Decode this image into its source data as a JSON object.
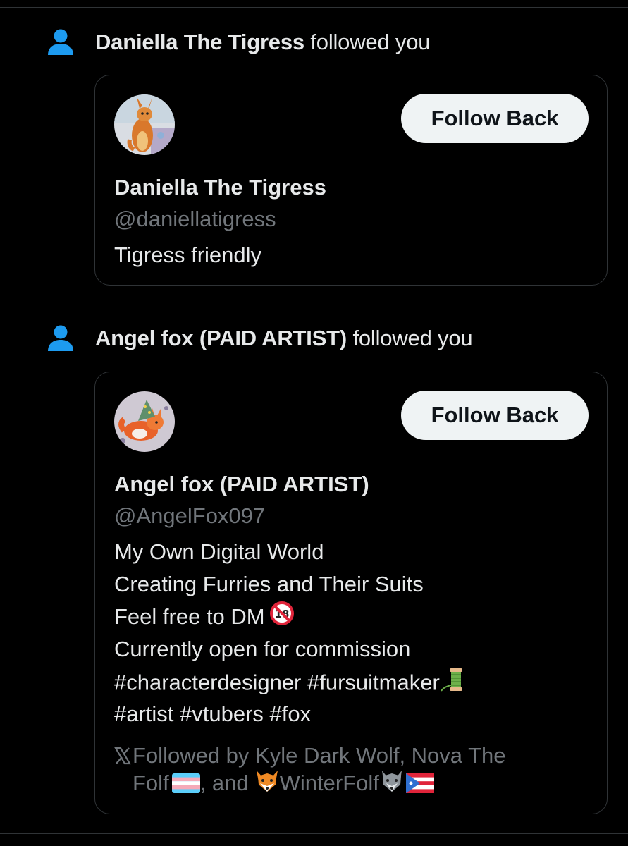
{
  "notifications": [
    {
      "actor_name": "Daniella The Tigress",
      "action": "followed you",
      "card": {
        "follow_button": "Follow Back",
        "display_name": "Daniella The Tigress",
        "handle": "@daniellatigress",
        "bio": [
          "Tigress friendly"
        ]
      }
    },
    {
      "actor_name": "Angel fox (PAID ARTIST)",
      "action": "followed you",
      "card": {
        "follow_button": "Follow Back",
        "display_name": "Angel fox (PAID ARTIST)",
        "handle": "@AngelFox097",
        "bio": [
          "My Own Digital World",
          "Creating Furries and Their Suits",
          "Feel free to DM",
          "Currently open for commission",
          "#characterdesigner #fursuitmaker",
          "#artist #vtubers #fox"
        ],
        "followed_by": {
          "line1": "Followed by Kyle Dark Wolf, Nova The",
          "line2_a": "Folf",
          "line2_b": ", and",
          "line2_c": "WinterFolf"
        }
      }
    }
  ],
  "icons": {
    "notification_type": "person-icon",
    "no_under_18": "no-under-18-icon",
    "thread_spool": "spool-of-thread-icon",
    "x_logo": "x-logo-icon",
    "trans_flag": "transgender-flag-icon",
    "fox_face": "fox-face-icon",
    "wolf_face": "wolf-face-icon",
    "pr_flag": "puerto-rico-flag-icon"
  },
  "colors": {
    "background": "#000000",
    "text_primary": "#e7e9ea",
    "text_secondary": "#71767b",
    "accent": "#1d9bf0",
    "border": "#2f3336",
    "button_bg": "#eff3f4",
    "button_text": "#0f1419"
  }
}
